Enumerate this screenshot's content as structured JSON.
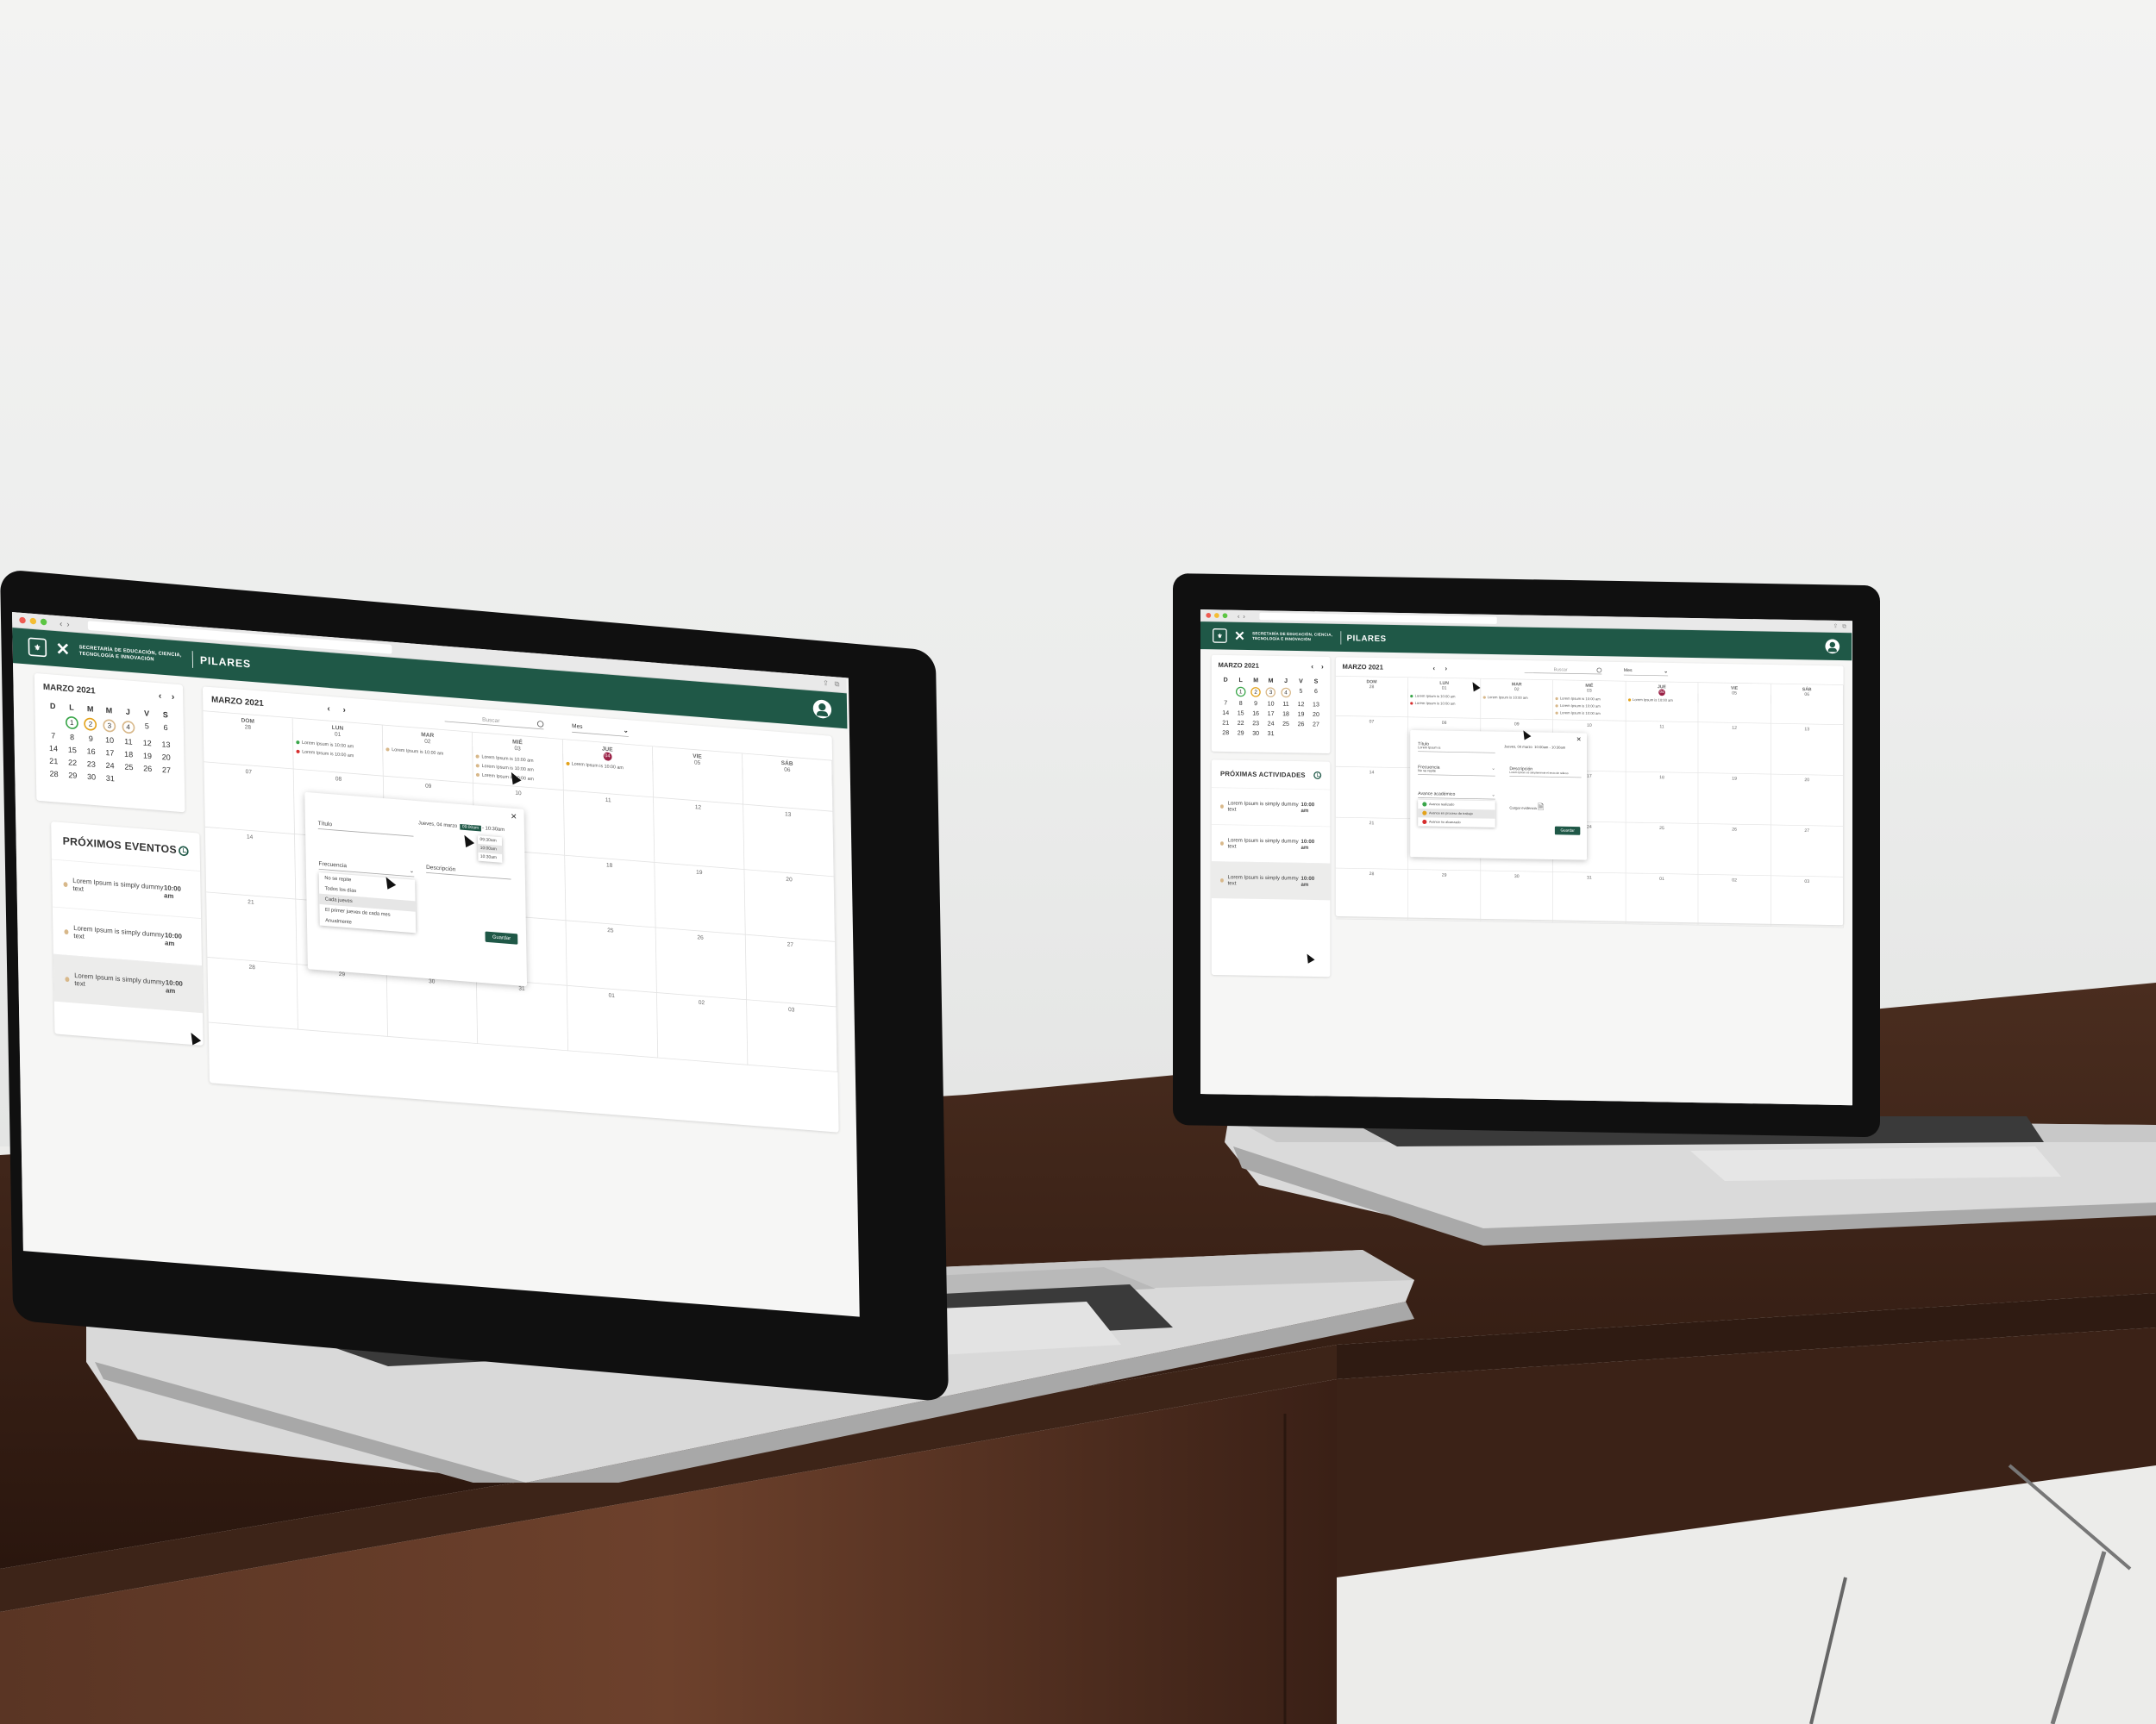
{
  "browser": {
    "back": "‹",
    "forward": "›"
  },
  "header": {
    "org_line1": "SECRETARÍA DE EDUCACIÓN, CIENCIA,",
    "org_line2": "TECNOLOGÍA E INNOVACIÓN",
    "brand": "PILARES"
  },
  "mini_calendar": {
    "title": "MARZO 2021",
    "prev": "‹",
    "next": "›",
    "weekdays": [
      "D",
      "L",
      "M",
      "M",
      "J",
      "V",
      "S"
    ],
    "weeks": [
      [
        "",
        "1",
        "2",
        "3",
        "4",
        "5",
        "6"
      ],
      [
        "7",
        "8",
        "9",
        "10",
        "11",
        "12",
        "13"
      ],
      [
        "14",
        "15",
        "16",
        "17",
        "18",
        "19",
        "20"
      ],
      [
        "21",
        "22",
        "23",
        "24",
        "25",
        "26",
        "27"
      ],
      [
        "28",
        "29",
        "30",
        "31",
        "",
        "",
        ""
      ]
    ],
    "ring_colors": {
      "1": "#3aa64a",
      "2": "#e3a21a",
      "3": "#d8b88a",
      "4": "#d8b88a"
    }
  },
  "events_left": {
    "title": "PRÓXIMOS EVENTOS",
    "items": [
      {
        "text": "Lorem Ipsum is simply dummy text",
        "time": "10:00 am"
      },
      {
        "text": "Lorem Ipsum is simply dummy text",
        "time": "10:00 am"
      },
      {
        "text": "Lorem Ipsum is simply dummy text",
        "time": "10:00 am"
      }
    ]
  },
  "events_right": {
    "title": "PRÓXIMAS ACTIVIDADES",
    "items": [
      {
        "text": "Lorem Ipsum is simply dummy text",
        "time": "10:00 am"
      },
      {
        "text": "Lorem Ipsum is simply dummy text",
        "time": "10:00 am"
      },
      {
        "text": "Lorem Ipsum is simply dummy text",
        "time": "10:00 am"
      }
    ]
  },
  "main_calendar": {
    "title": "MARZO 2021",
    "prev": "‹",
    "next": "›",
    "search_placeholder": "Buscar",
    "view": "Mes",
    "day_names": [
      "DOM",
      "LUN",
      "MAR",
      "MIÉ",
      "JUE",
      "VIE",
      "SÁB"
    ],
    "header_dates": [
      "28",
      "01",
      "02",
      "03",
      "04",
      "05",
      "06"
    ],
    "event_text": "Lorem Ipsum is 10:00 am",
    "event_text_right": "Lorem Ipsum is 10:00 am",
    "weeks": [
      [
        "07",
        "08",
        "09",
        "10",
        "11",
        "12",
        "13"
      ],
      [
        "14",
        "15",
        "16",
        "17",
        "18",
        "19",
        "20"
      ],
      [
        "21",
        "22",
        "23",
        "24",
        "25",
        "26",
        "27"
      ],
      [
        "28",
        "29",
        "30",
        "31",
        "01",
        "02",
        "03"
      ]
    ],
    "weeks_right": [
      [
        "07",
        "08",
        "09",
        "10",
        "11",
        "12",
        "13"
      ],
      [
        "14",
        "15",
        "16",
        "17",
        "18",
        "19",
        "20"
      ],
      [
        "21",
        "22",
        "23",
        "24",
        "25",
        "26",
        "27"
      ],
      [
        "28",
        "29",
        "30",
        "31",
        "01",
        "02",
        "03"
      ]
    ],
    "colors": {
      "green": "#3aa64a",
      "red": "#d62e2e",
      "beige": "#d8b88a",
      "orange": "#e3a21a"
    }
  },
  "modal_left": {
    "title_label": "Título",
    "date": "Jueves, 04 marzo",
    "time_start": "09:00am",
    "dash": "-",
    "time_end": "10:30am",
    "time_options": [
      "09:30am",
      "10:00am",
      "10:30am"
    ],
    "frequency_label": "Frecuencia",
    "description_label": "Descripción",
    "frequency_options": [
      "No se repite",
      "Todos los días",
      "Cada jueves",
      "El primer jueves de cada mes",
      "Anualmente"
    ],
    "save": "Guardar"
  },
  "modal_right": {
    "title_label": "Título",
    "title_value": "Lorem Ipsum is",
    "date": "Jueves, 04 marzo",
    "time_start": "10:00am",
    "dash": "-",
    "time_end": "10:30am",
    "frequency_label": "Frecuencia",
    "frequency_value": "No se repite",
    "description_label": "Descripción",
    "description_value": "Lorem Ipsum es simplemente el texto de relleno",
    "progress_label": "Avance académico",
    "progress_options": [
      {
        "label": "Avance realizado",
        "color": "#3aa64a"
      },
      {
        "label": "Avance en proceso de trabajo",
        "color": "#e3a21a"
      },
      {
        "label": "Avance no alcanzado",
        "color": "#d62e2e"
      }
    ],
    "evidence": "Cargar evidencia",
    "save": "Guardar"
  }
}
